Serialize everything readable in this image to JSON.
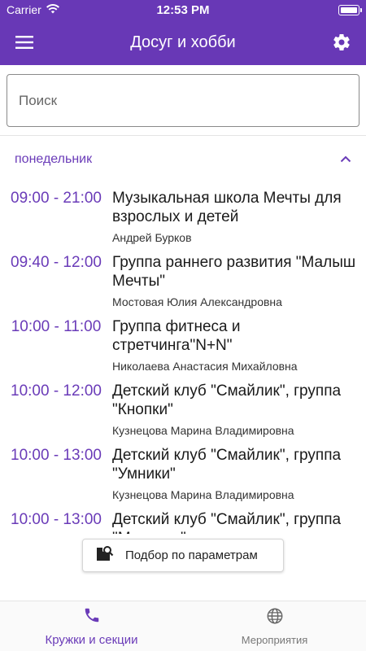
{
  "status_bar": {
    "carrier": "Carrier",
    "time": "12:53 PM"
  },
  "app_bar": {
    "title": "Досуг и хобби",
    "menu_icon": "hamburger-menu-icon",
    "settings_icon": "gear-icon"
  },
  "search": {
    "placeholder": "Поиск",
    "value": ""
  },
  "schedule": {
    "day": "понедельник",
    "items": [
      {
        "time": "09:00 - 21:00",
        "name": "Музыкальная школа Мечты для взрослых и детей",
        "teacher": "Андрей Бурков"
      },
      {
        "time": "09:40 - 12:00",
        "name": "Группа раннего развития \"Малыш Мечты\"",
        "teacher": "Мостовая Юлия Александровна"
      },
      {
        "time": "10:00 - 11:00",
        "name": "Группа фитнеса и стретчинга\"N+N\"",
        "teacher": "Николаева Анастасия Михайловна"
      },
      {
        "time": "10:00 - 12:00",
        "name": "Детский клуб \"Смайлик\", группа \"Кнопки\"",
        "teacher": "Кузнецова Марина Владимировна"
      },
      {
        "time": "10:00 - 13:00",
        "name": "Детский клуб \"Смайлик\", группа \"Умники\"",
        "teacher": "Кузнецова Марина Владимировна"
      },
      {
        "time": "10:00 - 13:00",
        "name": "Детский клуб \"Смайлик\", группа \"Малыши\"",
        "teacher": ""
      }
    ]
  },
  "filter_button": {
    "label": "Подбор по параметрам"
  },
  "bottom_nav": {
    "items": [
      {
        "label": "Кружки и секции",
        "icon": "phone-icon",
        "active": true
      },
      {
        "label": "Мероприятия",
        "icon": "globe-icon",
        "active": false
      }
    ]
  },
  "colors": {
    "primary": "#6838b6",
    "accent": "#6a3bb8",
    "text": "#1a1a1a"
  }
}
